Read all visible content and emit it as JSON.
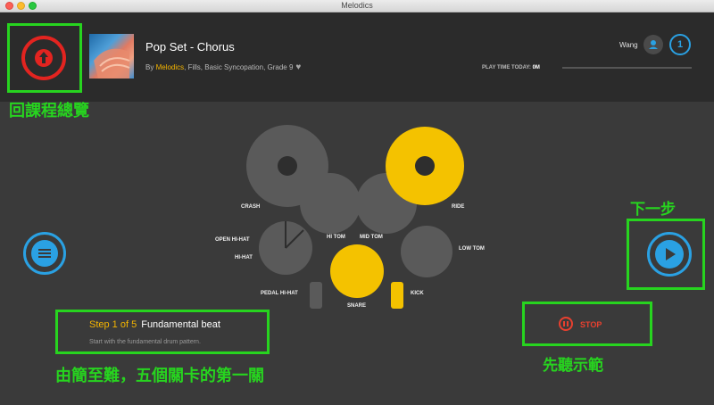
{
  "window": {
    "title": "Melodics"
  },
  "header": {
    "song_title": "Pop Set - Chorus",
    "meta_prefix": "By ",
    "meta_brand": "Melodics",
    "meta_tags": ", Fills, Basic Syncopation, Grade 9",
    "username": "Wang",
    "level": "1",
    "playtime_label": "PLAY TIME TODAY:",
    "playtime_value": "0M"
  },
  "annotations": {
    "back": "回課程總覽",
    "next": "下一步",
    "step": "由簡至難，五個關卡的第一關",
    "stop": "先聽示範"
  },
  "drums": {
    "crash": "CRASH",
    "ride": "RIDE",
    "open_hihat": "OPEN HI-HAT",
    "hihat": "HI-HAT",
    "hi_tom": "HI TOM",
    "mid_tom": "MID TOM",
    "low_tom": "LOW TOM",
    "pedal_hihat": "PEDAL HI-HAT",
    "snare": "SNARE",
    "kick": "KICK"
  },
  "step": {
    "count": "Step 1 of 5",
    "name": "Fundamental beat",
    "description": "Start with the fundamental drum pattern."
  },
  "controls": {
    "stop_label": "STOP"
  },
  "colors": {
    "accent_yellow": "#f4b400",
    "accent_blue": "#2aa1e3",
    "annotation_green": "#27d41f",
    "back_red": "#e32420",
    "stop_red": "#e8402f",
    "drum_gray": "#5a5a5a"
  },
  "icons": {
    "back": "arrow-up-icon",
    "menu": "menu-lines-icon",
    "next": "play-icon",
    "stop": "pause-icon",
    "user": "user-icon",
    "favorite": "heart-icon"
  }
}
